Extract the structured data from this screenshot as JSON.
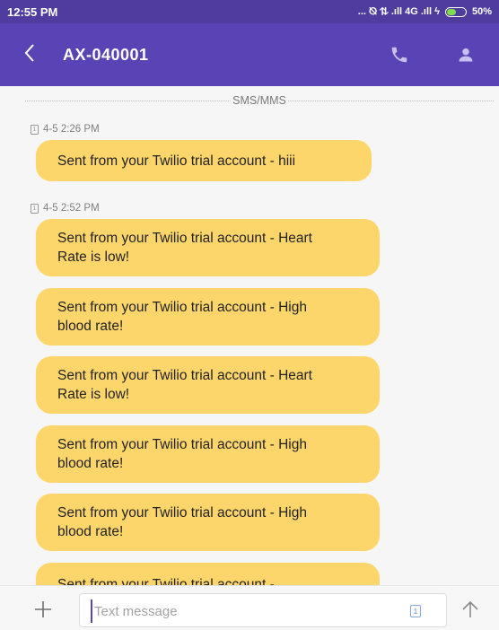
{
  "status_bar": {
    "time": "12:55 PM",
    "right_text": "... ⦰ ⇅ .ıll 4G .ıll ϟ",
    "battery_label": "50%",
    "battery_level": 0.5
  },
  "app_bar": {
    "back_label": "‹",
    "contact": "AX-040001",
    "call_icon": "phone-icon",
    "contact_icon": "person-icon"
  },
  "thread": {
    "divider_label": "SMS/MMS",
    "groups": [
      {
        "stamp": "4-5 2:26 PM",
        "messages": [
          "Sent from your Twilio trial account - hiii"
        ]
      },
      {
        "stamp": "4-5 2:52 PM",
        "messages": [
          "Sent from your Twilio trial account - Heart Rate is low!",
          "Sent from your Twilio trial account - High blood rate!",
          "Sent from your Twilio trial account - Heart Rate is low!",
          "Sent from your Twilio trial account - High blood rate!",
          "Sent from your Twilio trial account - High blood rate!",
          "Sent from your Twilio trial account -"
        ]
      }
    ],
    "sim_badge": "1"
  },
  "composer": {
    "placeholder": "Text message",
    "value": "",
    "sim_badge": "1"
  },
  "colors": {
    "status_bar": "#4f3c9e",
    "app_bar": "#5a44b5",
    "bubble": "#fdd66b"
  }
}
